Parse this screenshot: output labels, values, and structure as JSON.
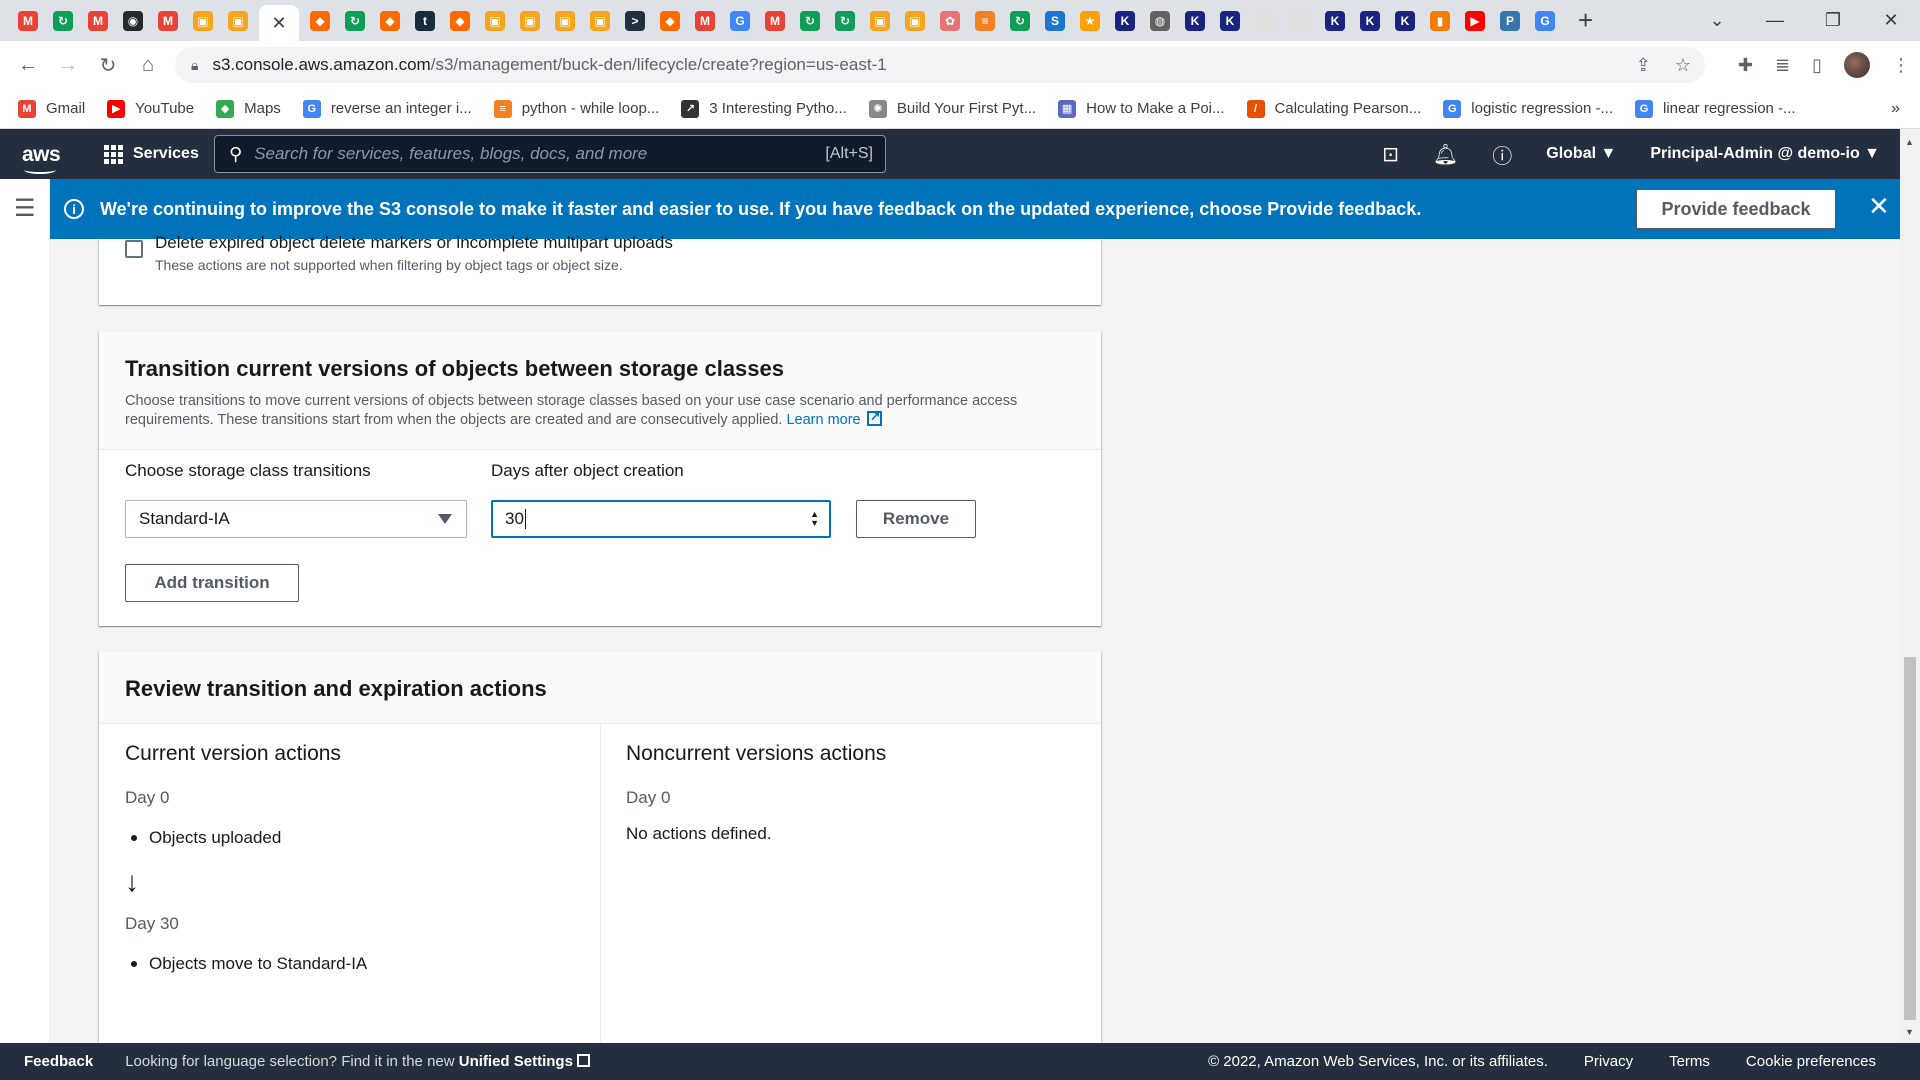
{
  "browser": {
    "tab_favicons": [
      {
        "icon": "gmail-icon",
        "color": "#ea4335",
        "glyph": "M"
      },
      {
        "icon": "refresh-app-icon",
        "color": "#0f9d58",
        "glyph": "↻"
      },
      {
        "icon": "gmail-icon",
        "color": "#ea4335",
        "glyph": "M"
      },
      {
        "icon": "github-icon",
        "color": "#24292e",
        "glyph": "◉"
      },
      {
        "icon": "gmail-icon",
        "color": "#ea4335",
        "glyph": "M"
      },
      {
        "icon": "aws-box-icon",
        "color": "#f7a51c",
        "glyph": "▣"
      },
      {
        "icon": "aws-box-icon",
        "color": "#f7a51c",
        "glyph": "▣"
      },
      {
        "icon": "aws-orange-icon",
        "color": "#ff6a00",
        "glyph": "◆"
      },
      {
        "icon": "refresh-app-icon",
        "color": "#0f9d58",
        "glyph": "↻"
      },
      {
        "icon": "aws-orange-icon",
        "color": "#ff6a00",
        "glyph": "◆"
      },
      {
        "icon": "tds-icon",
        "color": "#1a2b3c",
        "glyph": "t"
      },
      {
        "icon": "aws-orange-icon",
        "color": "#ff6a00",
        "glyph": "◆"
      },
      {
        "icon": "aws-box-icon",
        "color": "#f7a51c",
        "glyph": "▣"
      },
      {
        "icon": "aws-box-icon",
        "color": "#f7a51c",
        "glyph": "▣"
      },
      {
        "icon": "aws-box-icon",
        "color": "#f7a51c",
        "glyph": "▣"
      },
      {
        "icon": "aws-box-icon",
        "color": "#f7a51c",
        "glyph": "▣"
      },
      {
        "icon": "terminal-icon",
        "color": "#232f3e",
        "glyph": ">"
      },
      {
        "icon": "aws-orange-icon",
        "color": "#ff6a00",
        "glyph": "◆"
      },
      {
        "icon": "gmail-icon",
        "color": "#ea4335",
        "glyph": "M"
      },
      {
        "icon": "google-icon",
        "color": "#4285f4",
        "glyph": "G"
      },
      {
        "icon": "gmail-icon",
        "color": "#ea4335",
        "glyph": "M"
      },
      {
        "icon": "refresh-app-icon",
        "color": "#0f9d58",
        "glyph": "↻"
      },
      {
        "icon": "refresh-app-icon",
        "color": "#0f9d58",
        "glyph": "↻"
      },
      {
        "icon": "aws-box-icon",
        "color": "#f7a51c",
        "glyph": "▣"
      },
      {
        "icon": "aws-box-icon",
        "color": "#f7a51c",
        "glyph": "▣"
      },
      {
        "icon": "brain-icon",
        "color": "#e57373",
        "glyph": "✿"
      },
      {
        "icon": "stackoverflow-icon",
        "color": "#f48024",
        "glyph": "≡"
      },
      {
        "icon": "refresh-app-icon",
        "color": "#0f9d58",
        "glyph": "↻"
      },
      {
        "icon": "s-icon",
        "color": "#1976d2",
        "glyph": "S"
      },
      {
        "icon": "star-badge-icon",
        "color": "#ffa000",
        "glyph": "★"
      },
      {
        "icon": "kaggle-icon",
        "color": "#1a237e",
        "glyph": "K"
      },
      {
        "icon": "globe-icon",
        "color": "#616161",
        "glyph": "◍"
      },
      {
        "icon": "kaggle-icon",
        "color": "#1a237e",
        "glyph": "K"
      },
      {
        "icon": "kaggle-icon",
        "color": "#1a237e",
        "glyph": "K"
      },
      {
        "icon": "blank-page-icon",
        "color": "#e0e0e0",
        "glyph": ""
      },
      {
        "icon": "blank-page-icon",
        "color": "#e0e0e0",
        "glyph": ""
      },
      {
        "icon": "kaggle-icon",
        "color": "#1a237e",
        "glyph": "K"
      },
      {
        "icon": "kaggle-icon",
        "color": "#1a237e",
        "glyph": "K"
      },
      {
        "icon": "kaggle-icon",
        "color": "#1a237e",
        "glyph": "K"
      },
      {
        "icon": "chart-icon",
        "color": "#f57c00",
        "glyph": "▮"
      },
      {
        "icon": "youtube-icon",
        "color": "#ff0000",
        "glyph": "▶"
      },
      {
        "icon": "python-icon",
        "color": "#3776ab",
        "glyph": "P"
      },
      {
        "icon": "google-icon",
        "color": "#4285f4",
        "glyph": "G"
      }
    ],
    "address_host": "s3.console.aws.amazon.com",
    "address_path": "/s3/management/buck-den/lifecycle/create?region=us-east-1",
    "bookmarks": [
      {
        "label": "Gmail",
        "icon": "gmail-icon",
        "color": "#ea4335",
        "glyph": "M"
      },
      {
        "label": "YouTube",
        "icon": "youtube-icon",
        "color": "#ff0000",
        "glyph": "▶"
      },
      {
        "label": "Maps",
        "icon": "maps-icon",
        "color": "#34a853",
        "glyph": "◆"
      },
      {
        "label": "reverse an integer i...",
        "icon": "google-icon",
        "color": "#4285f4",
        "glyph": "G"
      },
      {
        "label": "python - while loop...",
        "icon": "stackoverflow-icon",
        "color": "#f48024",
        "glyph": "≡"
      },
      {
        "label": "3 Interesting Pytho...",
        "icon": "trend-icon",
        "color": "#333333",
        "glyph": "↗"
      },
      {
        "label": "Build Your First Pyt...",
        "icon": "openai-icon",
        "color": "#888888",
        "glyph": "✺"
      },
      {
        "label": "How to Make a Poi...",
        "icon": "grid-logo-icon",
        "color": "#5c6bc0",
        "glyph": "▦"
      },
      {
        "label": "Calculating Pearson...",
        "icon": "slash-logo-icon",
        "color": "#e65100",
        "glyph": "/"
      },
      {
        "label": "logistic regression -...",
        "icon": "google-icon",
        "color": "#4285f4",
        "glyph": "G"
      },
      {
        "label": "linear regression -...",
        "icon": "google-icon",
        "color": "#4285f4",
        "glyph": "G"
      }
    ]
  },
  "aws_nav": {
    "logo": "aws",
    "services_label": "Services",
    "search_placeholder": "Search for services, features, blogs, docs, and more",
    "search_shortcut": "[Alt+S]",
    "region": "Global ▼",
    "account": "Principal-Admin @ demo-io ▼"
  },
  "flash": {
    "message_prefix": "We're continuing to improve the S3 console to make it faster and easier to use. If you have feedback on the updated experience, choose ",
    "message_link": "Provide feedback",
    "message_suffix": ".",
    "button_label": "Provide feedback",
    "color": "#0073bb"
  },
  "top_panel": {
    "checkbox_label": "Delete expired object delete markers or incomplete multipart uploads",
    "checkbox_sub": "These actions are not supported when filtering by object tags or object size."
  },
  "transition_panel": {
    "title": "Transition current versions of objects between storage classes",
    "description": "Choose transitions to move current versions of objects between storage classes based on your use case scenario and performance access requirements. These transitions start from when the objects are created and are consecutively applied.",
    "learn_more": "Learn more",
    "storage_class_label": "Choose storage class transitions",
    "storage_class_value": "Standard-IA",
    "days_label": "Days after object creation",
    "days_value": "30",
    "remove_label": "Remove",
    "add_label": "Add transition"
  },
  "review_panel": {
    "title": "Review transition and expiration actions",
    "current": {
      "heading": "Current version actions",
      "day0": "Day 0",
      "day0_item": "Objects uploaded",
      "day30": "Day 30",
      "day30_item": "Objects move to Standard-IA"
    },
    "noncurrent": {
      "heading": "Noncurrent versions actions",
      "day0": "Day 0",
      "none": "No actions defined."
    }
  },
  "footer": {
    "feedback": "Feedback",
    "lang_text": "Looking for language selection? Find it in the new ",
    "lang_link": "Unified Settings",
    "copyright": "© 2022, Amazon Web Services, Inc. or its affiliates.",
    "privacy": "Privacy",
    "terms": "Terms",
    "cookies": "Cookie preferences"
  }
}
